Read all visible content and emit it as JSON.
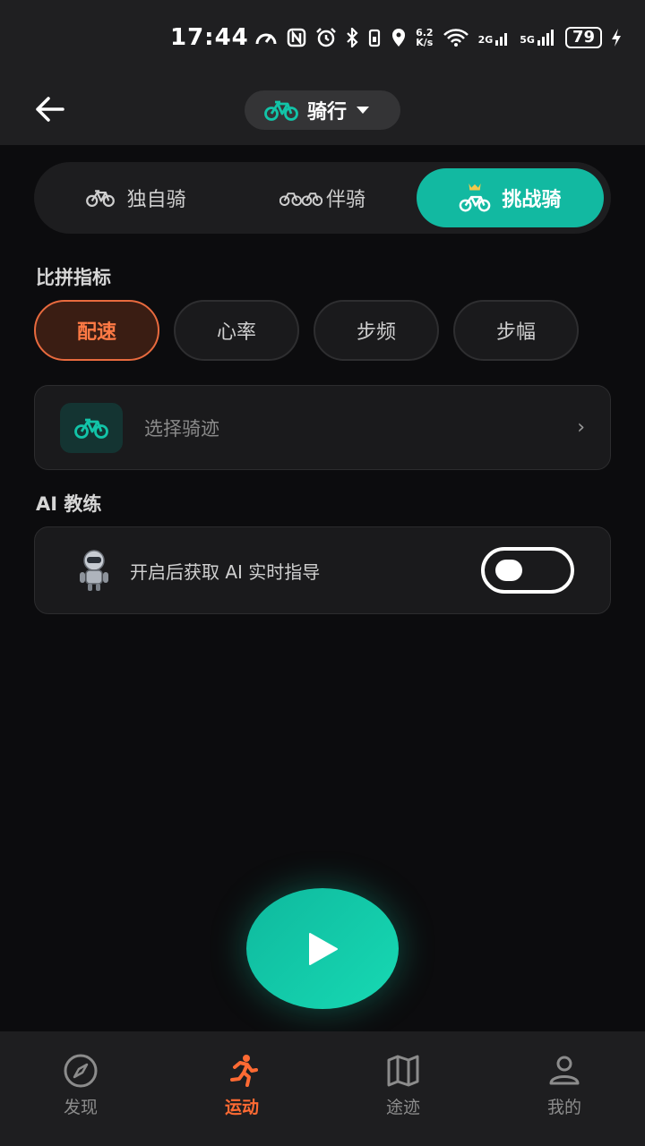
{
  "status_bar": {
    "time": "17:44",
    "net_speed_value": "6.2",
    "net_speed_unit": "K/s",
    "signal_1": "2G",
    "signal_2": "5G",
    "battery": "79",
    "icons": [
      "speedometer-icon",
      "nfc-icon",
      "alarm-icon",
      "bluetooth-icon",
      "vibrate-icon",
      "location-icon",
      "wifi-icon",
      "signal-icon",
      "charging-icon"
    ]
  },
  "header": {
    "back_icon": "arrow-left-icon",
    "sport_type": "骑行",
    "sport_icon": "bicycle-icon",
    "dropdown_icon": "caret-down-icon"
  },
  "mode_tabs": [
    {
      "label": "独自骑",
      "icon": "bicycle-icon",
      "active": false
    },
    {
      "label": "伴骑",
      "icon": "group-bicycles-icon",
      "active": false
    },
    {
      "label": "挑战骑",
      "icon": "crown-bicycle-icon",
      "active": true
    }
  ],
  "metrics_section": {
    "title": "比拼指标",
    "options": [
      {
        "label": "配速",
        "active": true
      },
      {
        "label": "心率",
        "active": false
      },
      {
        "label": "步频",
        "active": false
      },
      {
        "label": "步幅",
        "active": false
      }
    ]
  },
  "route": {
    "placeholder": "选择骑迹",
    "chevron": "›"
  },
  "ai_coach": {
    "title": "AI 教练",
    "description": "开启后获取 AI 实时指导",
    "enabled": false
  },
  "start_button": {
    "icon": "play-icon"
  },
  "bottom_nav": [
    {
      "label": "发现",
      "icon": "compass-icon",
      "active": false
    },
    {
      "label": "运动",
      "icon": "running-icon",
      "active": true
    },
    {
      "label": "途迹",
      "icon": "map-icon",
      "active": false
    },
    {
      "label": "我的",
      "icon": "profile-icon",
      "active": false
    }
  ],
  "colors": {
    "accent_teal": "#12b9a1",
    "accent_orange": "#ff6a33",
    "background": "#0c0c0e"
  }
}
